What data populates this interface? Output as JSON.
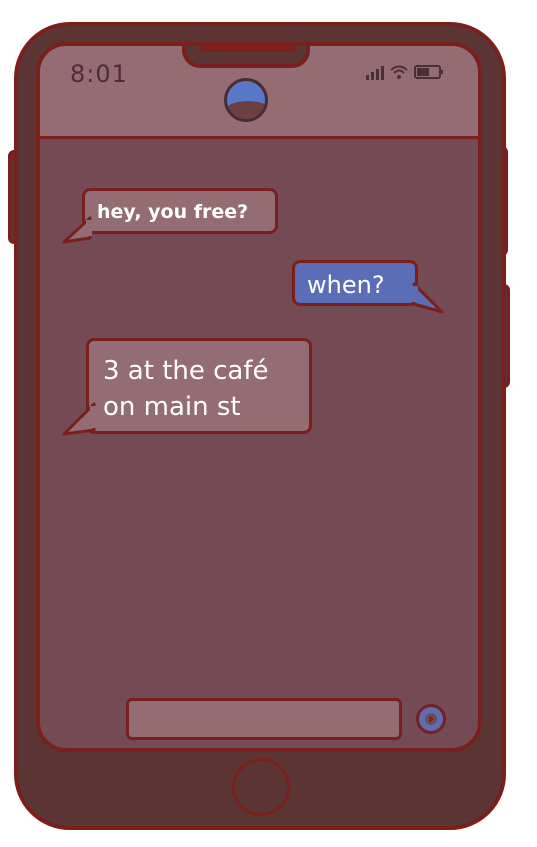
{
  "status_bar": {
    "time": "8:01",
    "signal_icon": "signal-bars-icon",
    "wifi_icon": "wifi-icon",
    "battery_icon": "battery-icon"
  },
  "contact": {
    "avatar_icon": "avatar-icon",
    "name": ""
  },
  "messages": [
    {
      "direction": "incoming",
      "text": "hey, you free?"
    },
    {
      "direction": "outgoing",
      "text": "when?"
    },
    {
      "direction": "incoming",
      "line1": "3 at the café",
      "line2": "on main st"
    }
  ],
  "composer": {
    "placeholder": "",
    "send_icon": "send-icon"
  },
  "colors": {
    "phone_body": "#5b3434",
    "outline": "#7a1f1c",
    "screen": "#744b54",
    "header": "#936c74",
    "incoming_bubble": "#936c74",
    "outgoing_bubble": "#5c6db8"
  }
}
